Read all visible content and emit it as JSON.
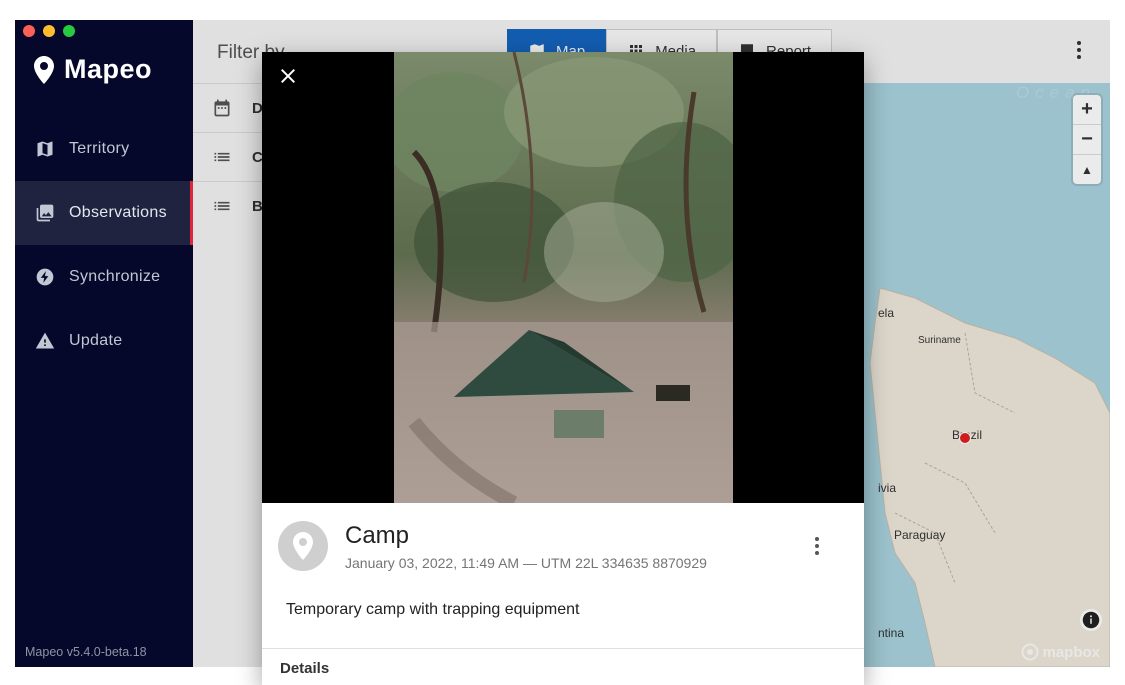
{
  "app": {
    "name": "Mapeo",
    "version": "Mapeo v5.4.0-beta.18"
  },
  "sidebar": {
    "items": [
      {
        "label": "Territory",
        "icon": "map-icon"
      },
      {
        "label": "Observations",
        "icon": "photo-library-icon",
        "active": true
      },
      {
        "label": "Synchronize",
        "icon": "sync-bolt-icon"
      },
      {
        "label": "Update",
        "icon": "warning-icon"
      }
    ]
  },
  "filter": {
    "title": "Filter by",
    "rows": [
      {
        "label": "Da",
        "icon": "calendar-icon"
      },
      {
        "label": "Ca",
        "icon": "list-icon"
      },
      {
        "label": "Bo",
        "icon": "list-icon"
      }
    ]
  },
  "topbar": {
    "tabs": [
      {
        "label": "Map",
        "icon": "map-icon",
        "active": true
      },
      {
        "label": "Media",
        "icon": "grid-icon"
      },
      {
        "label": "Report",
        "icon": "report-icon"
      }
    ]
  },
  "map": {
    "ocean_label": "Ocean",
    "labels": [
      "ela",
      "Suriname",
      "Brazil",
      "ivia",
      "Paraguay",
      "ntina"
    ],
    "attribution": "mapbox",
    "zoom_in": "+",
    "zoom_out": "−",
    "compass": "▲"
  },
  "observation": {
    "title": "Camp",
    "meta": "January 03, 2022, 11:49 AM — UTM 22L 334635 8870929",
    "description": "Temporary camp with trapping equipment",
    "details_label": "Details"
  },
  "colors": {
    "sidebar_bg": "#05082a",
    "active_accent": "#e0263c",
    "tab_active": "#1565c0",
    "map_water": "#a9d3df",
    "map_land": "#efe9dc",
    "marker": "#e02020"
  }
}
